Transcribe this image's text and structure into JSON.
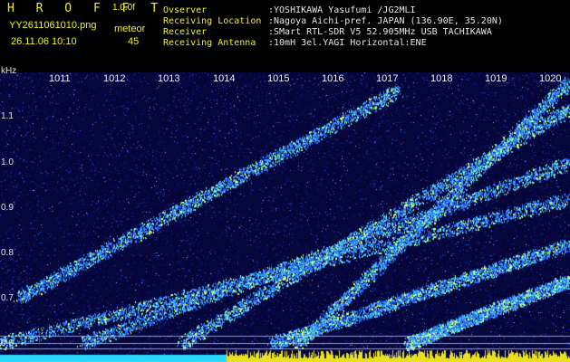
{
  "header": {
    "brand": "H R O F F T",
    "version": "1.0.0f",
    "filename": "YY2611061010.png",
    "datetime": "26.11.06 10:10",
    "meteor_label": "meteor",
    "meteor_count": "45",
    "info_keys": [
      "Ovserver",
      "Receiving Location",
      "Receiver",
      "Receiving Antenna"
    ],
    "info_vals": [
      ":YOSHIKAWA Yasufumi /JG2MLI",
      ":Nagoya Aichi-pref. JAPAN (136.90E, 35.20N)",
      ":SMart RTL-SDR V5 52.905MHz USB TACHIKAWA",
      ":10mH 3el.YAGI Horizontal:ENE"
    ]
  },
  "axis": {
    "y_unit": "kHz",
    "y_ticks": [
      "1.1",
      "1.0",
      "0.9",
      "0.8",
      "0.7",
      "0.6"
    ],
    "x_ticks": [
      "1011",
      "1012",
      "1013",
      "1014",
      "1015",
      "1016",
      "1017",
      "1018",
      "1019",
      "1020"
    ]
  },
  "colors": {
    "label": "#f2f21a",
    "info": "#e6e6e6",
    "background": "#000000",
    "spectrum_low": "#0a0a5a",
    "spectrum_mid": "#2a6cff",
    "trace": "#8fffa0",
    "baseline_cyan": "#2ad8ff",
    "baseline_yellow": "#e8e020"
  }
}
